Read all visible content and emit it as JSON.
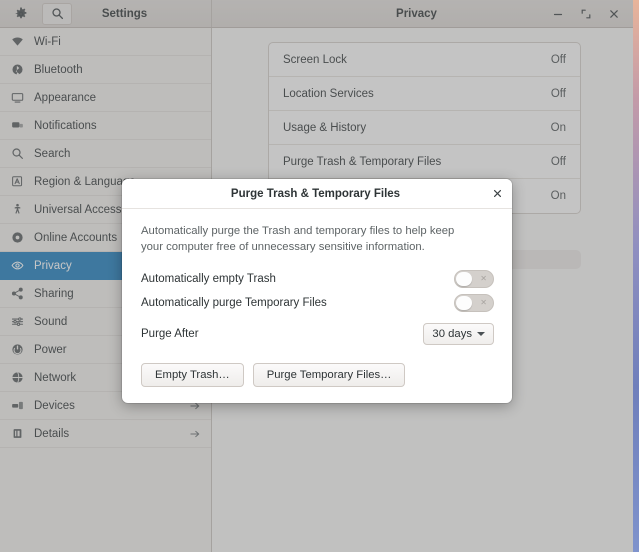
{
  "window": {
    "sidebar_title": "Settings",
    "panel_title": "Privacy",
    "controls": {
      "minimize": "Minimize",
      "maximize": "Restore",
      "close": "Close"
    },
    "header_buttons": {
      "app_menu": "gear-icon",
      "search": "search-icon"
    }
  },
  "sidebar": {
    "items": [
      {
        "label": "Wi-Fi",
        "icon": "wifi-icon",
        "selected": false,
        "arrow": ""
      },
      {
        "label": "Bluetooth",
        "icon": "bluetooth-icon",
        "selected": false,
        "arrow": ""
      },
      {
        "label": "Appearance",
        "icon": "appearance-icon",
        "selected": false,
        "arrow": ""
      },
      {
        "label": "Notifications",
        "icon": "notifications-icon",
        "selected": false,
        "arrow": ""
      },
      {
        "label": "Search",
        "icon": "search-icon",
        "selected": false,
        "arrow": ""
      },
      {
        "label": "Region & Language",
        "icon": "region-language-icon",
        "selected": false,
        "arrow": ""
      },
      {
        "label": "Universal Access",
        "icon": "universal-access-icon",
        "selected": false,
        "arrow": ""
      },
      {
        "label": "Online Accounts",
        "icon": "online-accounts-icon",
        "selected": false,
        "arrow": ""
      },
      {
        "label": "Privacy",
        "icon": "privacy-eye-icon",
        "selected": true,
        "arrow": ""
      },
      {
        "label": "Sharing",
        "icon": "sharing-icon",
        "selected": false,
        "arrow": ""
      },
      {
        "label": "Sound",
        "icon": "sound-icon",
        "selected": false,
        "arrow": ""
      },
      {
        "label": "Power",
        "icon": "power-icon",
        "selected": false,
        "arrow": ""
      },
      {
        "label": "Network",
        "icon": "network-icon",
        "selected": false,
        "arrow": ""
      },
      {
        "label": "Devices",
        "icon": "devices-icon",
        "selected": false,
        "arrow": "→"
      },
      {
        "label": "Details",
        "icon": "details-icon",
        "selected": false,
        "arrow": "→"
      }
    ],
    "selected_color": "#1c7cbd"
  },
  "privacy_panel": {
    "rows": [
      {
        "label": "Screen Lock",
        "value": "Off"
      },
      {
        "label": "Location Services",
        "value": "Off"
      },
      {
        "label": "Usage & History",
        "value": "On"
      },
      {
        "label": "Purge Trash & Temporary Files",
        "value": "Off"
      },
      {
        "label": "",
        "value": "On"
      }
    ]
  },
  "dialog": {
    "title": "Purge Trash & Temporary Files",
    "close_label": "✕",
    "description": "Automatically purge the Trash and temporary files to help keep your computer free of unnecessary sensitive information.",
    "toggles": [
      {
        "label": "Automatically empty Trash",
        "state": "off"
      },
      {
        "label": "Automatically purge Temporary Files",
        "state": "off"
      }
    ],
    "purge_after": {
      "label": "Purge After",
      "value": "30 days"
    },
    "buttons": [
      {
        "label": "Empty Trash…"
      },
      {
        "label": "Purge Temporary Files…"
      }
    ]
  }
}
